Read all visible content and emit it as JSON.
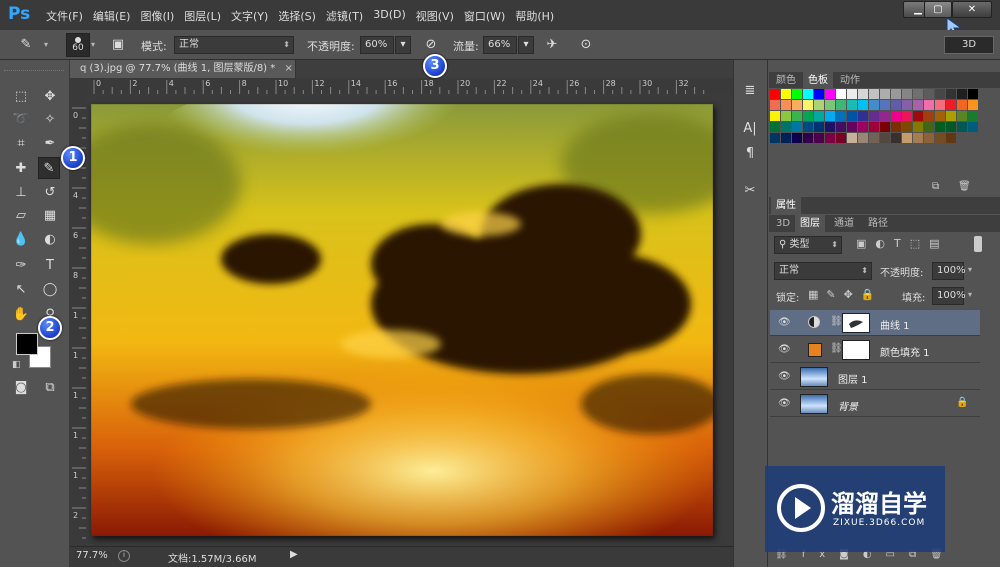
{
  "app": {
    "logo": "Ps"
  },
  "menu": [
    "文件(F)",
    "编辑(E)",
    "图像(I)",
    "图层(L)",
    "文字(Y)",
    "选择(S)",
    "滤镜(T)",
    "3D(D)",
    "视图(V)",
    "窗口(W)",
    "帮助(H)"
  ],
  "window": {
    "three_d": "3D"
  },
  "options": {
    "brush_size": "60",
    "mode_label": "模式:",
    "mode_value": "正常",
    "opacity_label": "不透明度:",
    "opacity_value": "60%",
    "flow_label": "流量:",
    "flow_value": "66%"
  },
  "document": {
    "tab_title": "q (3).jpg @ 77.7% (曲线 1, 图层蒙版/8) *",
    "tab_close": "×",
    "zoom": "77.7%",
    "doc_info": "文档:1.57M/3.66M",
    "ruler_top": [
      "0",
      "2",
      "4",
      "6",
      "8",
      "10",
      "12",
      "14",
      "16",
      "18",
      "20",
      "22",
      "24",
      "26",
      "28",
      "30",
      "32"
    ],
    "ruler_left": [
      "0",
      "2",
      "4",
      "6",
      "8",
      "1",
      "1",
      "1",
      "1",
      "1",
      "2"
    ]
  },
  "swatches": {
    "tabs": [
      "颜色",
      "色板",
      "动作"
    ],
    "colors": [
      "#ff0000",
      "#ffff00",
      "#00ff00",
      "#00ffff",
      "#0000ff",
      "#ff00ff",
      "#ffffff",
      "#ebebeb",
      "#d6d6d6",
      "#c2c2c2",
      "#adadad",
      "#999999",
      "#858585",
      "#707070",
      "#5c5c5c",
      "#474747",
      "#333333",
      "#1f1f1f",
      "#000000",
      "#f26c4f",
      "#f68e55",
      "#fbad5c",
      "#fff467",
      "#acd372",
      "#7cc576",
      "#3bb878",
      "#1abbb4",
      "#00bff3",
      "#438ccb",
      "#5574b9",
      "#605ca9",
      "#855fa8",
      "#a763a9",
      "#f06ea9",
      "#f26d7d",
      "#ee1c24",
      "#f26522",
      "#f7941d",
      "#fff200",
      "#8dc63f",
      "#39b54a",
      "#00a651",
      "#00a99d",
      "#00aeef",
      "#0072bc",
      "#0054a6",
      "#2e3192",
      "#662d91",
      "#92278f",
      "#ec008c",
      "#ed145b",
      "#9e0b0f",
      "#a0410d",
      "#a3620a",
      "#aba000",
      "#598527",
      "#197b30",
      "#007236",
      "#00746b",
      "#0076a3",
      "#004a80",
      "#003471",
      "#1b1464",
      "#440e62",
      "#630460",
      "#9e005d",
      "#9e0039",
      "#790000",
      "#7b2e00",
      "#7d4900",
      "#827b00",
      "#406618",
      "#005e20",
      "#005826",
      "#005952",
      "#005b7f",
      "#003663",
      "#002157",
      "#0d004c",
      "#32004b",
      "#4b0049",
      "#7b0046",
      "#7a0026",
      "#c7b299",
      "#998675",
      "#736357",
      "#534741",
      "#37302d",
      "#c69c6d",
      "#a67c52",
      "#8c6239",
      "#754c24",
      "#603913"
    ],
    "icons": [
      "new-swatch-icon",
      "trash-icon"
    ]
  },
  "properties": {
    "label": "属性"
  },
  "layers": {
    "tabs": [
      "3D",
      "图层",
      "通道",
      "路径"
    ],
    "filter_label": "类型",
    "blend_mode": "正常",
    "opacity_label": "不透明度:",
    "opacity_value": "100%",
    "lock_label": "锁定:",
    "fill_label": "填充:",
    "fill_value": "100%",
    "items": [
      {
        "name": "曲线 1",
        "selected": true
      },
      {
        "name": "颜色填充 1",
        "selected": false
      },
      {
        "name": "图层 1",
        "selected": false
      },
      {
        "name": "背景",
        "selected": false
      }
    ],
    "fill_color": "#e8821e"
  },
  "callouts": [
    "1",
    "2",
    "3"
  ],
  "watermark": {
    "title": "溜溜自学",
    "url": "ZIXUE.3D66.COM"
  }
}
